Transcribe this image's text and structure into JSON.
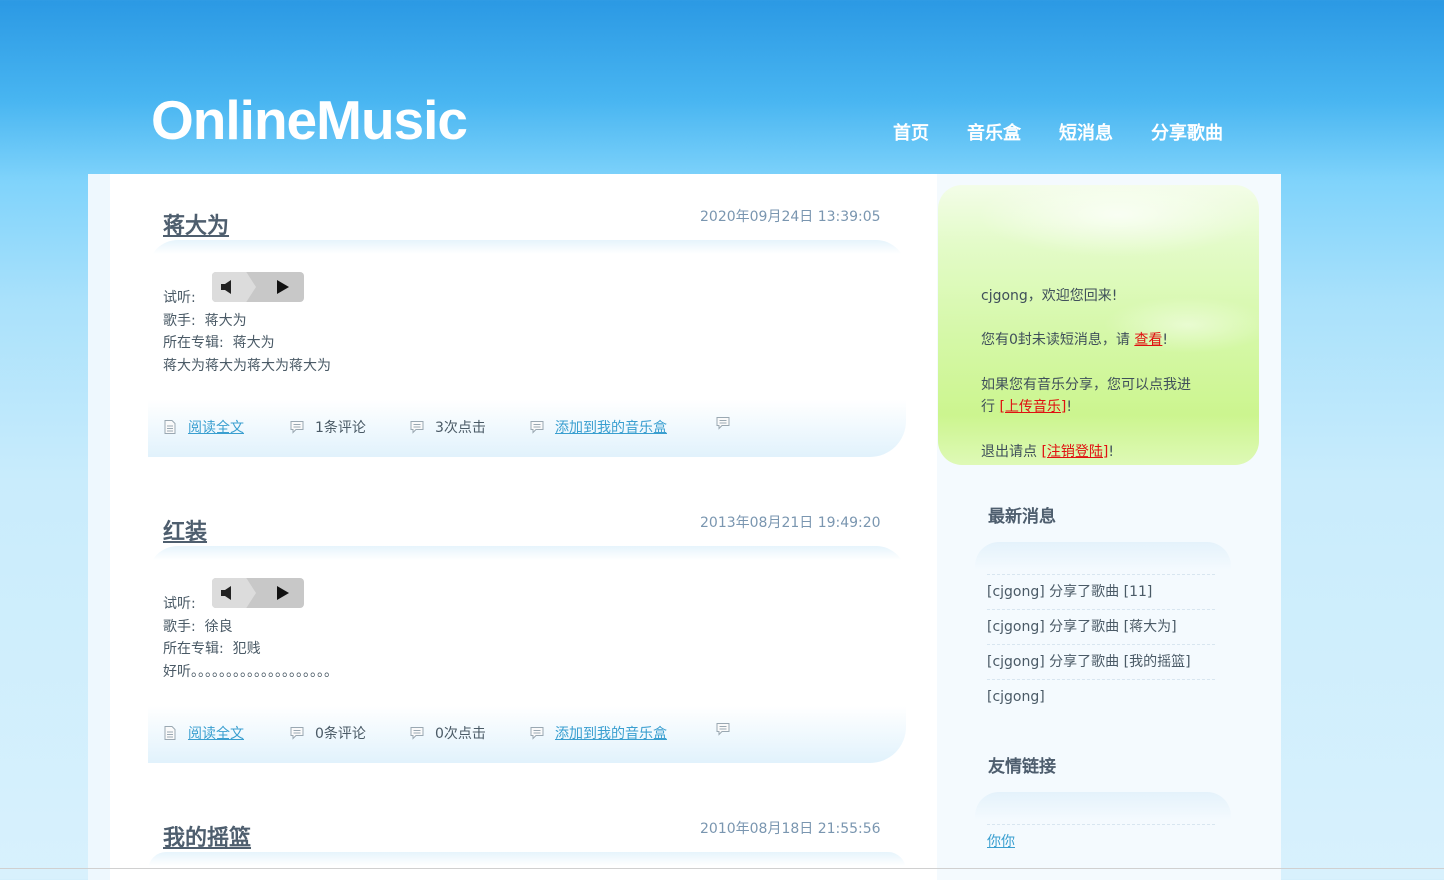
{
  "header": {
    "logo": "OnlineMusic",
    "nav": [
      {
        "label": "首页"
      },
      {
        "label": "音乐盒"
      },
      {
        "label": "短消息"
      },
      {
        "label": "分享歌曲"
      }
    ]
  },
  "posts": [
    {
      "title": "蒋大为",
      "date": "2020年09月24日 13:39:05",
      "listen_label": "试听:",
      "singer_label": "歌手:",
      "singer": "蒋大为",
      "album_label": "所在专辑:",
      "album": "蒋大为",
      "description": "蒋大为蒋大为蒋大为蒋大为",
      "read_more": "阅读全文",
      "comments": "1条评论",
      "clicks": "3次点击",
      "add_to_box": "添加到我的音乐盒"
    },
    {
      "title": "红装",
      "date": "2013年08月21日 19:49:20",
      "listen_label": "试听:",
      "singer_label": "歌手:",
      "singer": "徐良",
      "album_label": "所在专辑:",
      "album": "犯贱",
      "description": "好听。。。。。。。。。。。。。。。。。。。。",
      "read_more": "阅读全文",
      "comments": "0条评论",
      "clicks": "0次点击",
      "add_to_box": "添加到我的音乐盒"
    },
    {
      "title": "我的摇篮",
      "date": "2010年08月18日 21:55:56"
    }
  ],
  "sidebar": {
    "welcome": {
      "greeting": "cjgong，欢迎您回来!",
      "msg_prefix": "您有0封未读短消息，请 ",
      "msg_link": "查看",
      "msg_suffix": "!",
      "share_line1": "如果您有音乐分享，您可以点我进",
      "share_line2_prefix": "行 ",
      "share_link": "[上传音乐]",
      "share_suffix": "!",
      "logout_prefix": "退出请点 ",
      "logout_link": "[注销登陆]",
      "logout_suffix": "!"
    },
    "news_title": "最新消息",
    "news": [
      "[cjgong] 分享了歌曲 [11]",
      "[cjgong] 分享了歌曲 [蒋大为]",
      "[cjgong] 分享了歌曲 [我的摇篮]",
      "[cjgong]"
    ],
    "links_title": "友情链接",
    "links": [
      "你你"
    ]
  },
  "colors": {
    "accent_link": "#3a9fd0",
    "warning_link": "#e01010",
    "header_blue": "#2b99e4"
  }
}
